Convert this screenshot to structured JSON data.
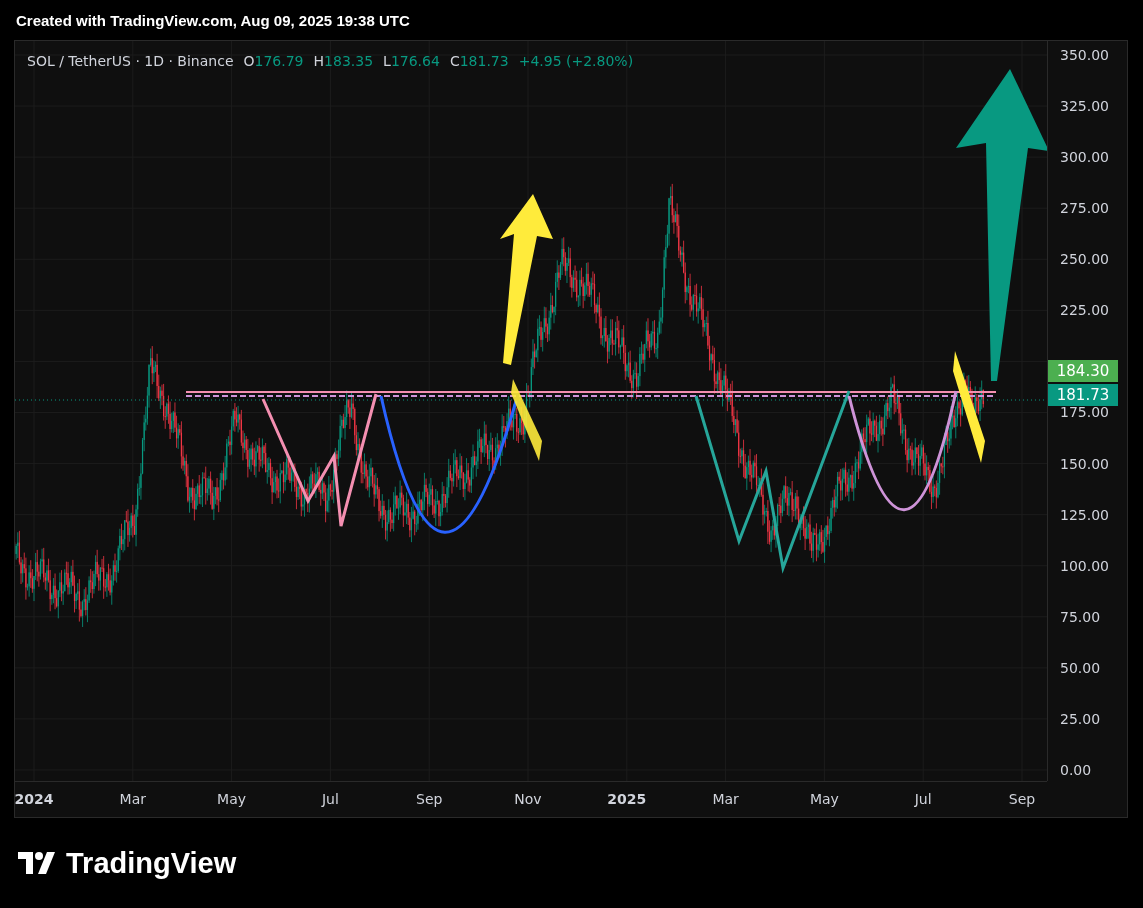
{
  "header": {
    "text": "Created with TradingView.com, Aug 09, 2025 19:38 UTC"
  },
  "legend": {
    "symbol": "SOL / TetherUS · 1D · Binance",
    "values": [
      {
        "label": "O",
        "value": "176.79"
      },
      {
        "label": "H",
        "value": "183.35"
      },
      {
        "label": "L",
        "value": "176.64"
      },
      {
        "label": "C",
        "value": "181.73"
      }
    ],
    "change": "+4.95 (+2.80%)"
  },
  "price_axis": {
    "ticks_above_tags": [
      "350.00",
      "325.00",
      "300.00",
      "275.00",
      "250.00",
      "225.00"
    ],
    "ticks_below_tags": [
      "175.00",
      "150.00",
      "125.00",
      "100.00",
      "75.00",
      "50.00",
      "25.00",
      "0.00"
    ]
  },
  "price_tags": [
    {
      "value": "184.30",
      "color": "#4caf50"
    },
    {
      "value": "181.73",
      "color": "#089981"
    }
  ],
  "time_axis": {
    "labels": [
      {
        "text": "2024",
        "kind": "year"
      },
      {
        "text": "Mar",
        "kind": "month"
      },
      {
        "text": "May",
        "kind": "month"
      },
      {
        "text": "Jul",
        "kind": "month"
      },
      {
        "text": "Sep",
        "kind": "month"
      },
      {
        "text": "Nov",
        "kind": "month"
      },
      {
        "text": "2025",
        "kind": "year"
      },
      {
        "text": "Mar",
        "kind": "month"
      },
      {
        "text": "May",
        "kind": "month"
      },
      {
        "text": "Jul",
        "kind": "month"
      },
      {
        "text": "Sep",
        "kind": "month"
      }
    ]
  },
  "logo": {
    "text": "TradingView"
  }
}
